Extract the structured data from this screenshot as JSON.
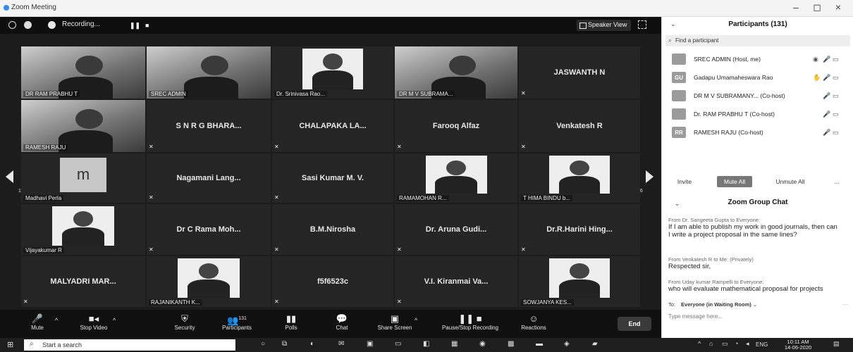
{
  "window": {
    "title": "Zoom Meeting",
    "minimize": "–",
    "maximize": "◻",
    "close": "×"
  },
  "topbar": {
    "recording_label": "Recording...",
    "speaker_view_label": "Speaker View"
  },
  "tiles": [
    {
      "row": 0,
      "col": 0,
      "kind": "video",
      "label": "DR RAM PRABHU T",
      "highlight": true
    },
    {
      "row": 0,
      "col": 1,
      "kind": "video",
      "label": "SREC ADMIN"
    },
    {
      "row": 0,
      "col": 2,
      "kind": "photo",
      "label": "Dr. Srinivasa Rao..."
    },
    {
      "row": 0,
      "col": 3,
      "kind": "video",
      "label": "DR M V SUBRAMA..."
    },
    {
      "row": 0,
      "col": 4,
      "kind": "name",
      "name": "JASWANTH N"
    },
    {
      "row": 1,
      "col": 0,
      "kind": "video",
      "label": "RAMESH RAJU"
    },
    {
      "row": 1,
      "col": 1,
      "kind": "name",
      "name": "S N R G BHARA..."
    },
    {
      "row": 1,
      "col": 2,
      "kind": "name",
      "name": "CHALAPAKA LA..."
    },
    {
      "row": 1,
      "col": 3,
      "kind": "name",
      "name": "Farooq Alfaz"
    },
    {
      "row": 1,
      "col": 4,
      "kind": "name",
      "name": "Venkatesh R"
    },
    {
      "row": 2,
      "col": 0,
      "kind": "avatar",
      "letter": "m",
      "label": "Madhavi Perla"
    },
    {
      "row": 2,
      "col": 1,
      "kind": "name",
      "name": "Nagamani Lang..."
    },
    {
      "row": 2,
      "col": 2,
      "kind": "name",
      "name": "Sasi Kumar M. V."
    },
    {
      "row": 2,
      "col": 3,
      "kind": "photo",
      "label": "RAMAMOHAN R..."
    },
    {
      "row": 2,
      "col": 4,
      "kind": "photo",
      "label": "T HIMA BINDU b..."
    },
    {
      "row": 3,
      "col": 0,
      "kind": "photo",
      "label": "Vijayakumar R"
    },
    {
      "row": 3,
      "col": 1,
      "kind": "name",
      "name": "Dr C Rama Moh..."
    },
    {
      "row": 3,
      "col": 2,
      "kind": "name",
      "name": "B.M.Nirosha"
    },
    {
      "row": 3,
      "col": 3,
      "kind": "name",
      "name": "Dr. Aruna Gudi..."
    },
    {
      "row": 3,
      "col": 4,
      "kind": "name",
      "name": "Dr.R.Harini Hing..."
    },
    {
      "row": 4,
      "col": 0,
      "kind": "name",
      "name": "MALYADRI MAR..."
    },
    {
      "row": 4,
      "col": 1,
      "kind": "photo",
      "label": "RAJANIKANTH K..."
    },
    {
      "row": 4,
      "col": 2,
      "kind": "name",
      "name": "f5f6523c"
    },
    {
      "row": 4,
      "col": 3,
      "kind": "name",
      "name": "V.I. Kiranmai Va..."
    },
    {
      "row": 4,
      "col": 4,
      "kind": "photo",
      "label": "SOWJANYA KES..."
    }
  ],
  "pagination": {
    "left": "1/6",
    "right": "1/6"
  },
  "toolbar": {
    "mute": "Mute",
    "stop_video": "Stop Video",
    "security": "Security",
    "participants": "Participants",
    "participants_count": "131",
    "polls": "Polls",
    "chat": "Chat",
    "share_screen": "Share Screen",
    "pause_recording": "Pause/Stop Recording",
    "reactions": "Reactions",
    "end": "End"
  },
  "participants_panel": {
    "title": "Participants (131)",
    "search_placeholder": "Find a participant",
    "rows": [
      {
        "initials": "",
        "name": "SREC ADMIN (Host, me)"
      },
      {
        "initials": "GU",
        "name": "Gadapu Umamaheswara Rao"
      },
      {
        "initials": "",
        "name": "DR M V SUBRAMANY... (Co-host)"
      },
      {
        "initials": "",
        "name": "Dr. RAM PRABHU T (Co-host)"
      },
      {
        "initials": "RR",
        "name": "RAMESH RAJU (Co-host)"
      }
    ],
    "invite": "Invite",
    "mute_all": "Mute All",
    "unmute_all": "Unmute All",
    "more": "..."
  },
  "chat": {
    "title": "Zoom Group Chat",
    "messages": [
      {
        "from": "From Dr. Sangeeta Gupta to Everyone:",
        "text": "If I am able to publish my work in good journals, then can I write a project proposal in the same lines?"
      },
      {
        "from": "From Venkatesh R to Me: (Privately)",
        "text": "Respected sir,"
      },
      {
        "from": "From Uday kumar Rampelli to Everyone:",
        "text": "who will evaluate mathematical proposal for projects"
      }
    ],
    "to_label": "To:",
    "to_value": "Everyone (in Waiting Room)",
    "placeholder": "Type message here..."
  },
  "taskbar": {
    "search_placeholder": "Start a search",
    "lang": "ENG",
    "time": "10:11 AM",
    "date": "14-06-2020"
  }
}
